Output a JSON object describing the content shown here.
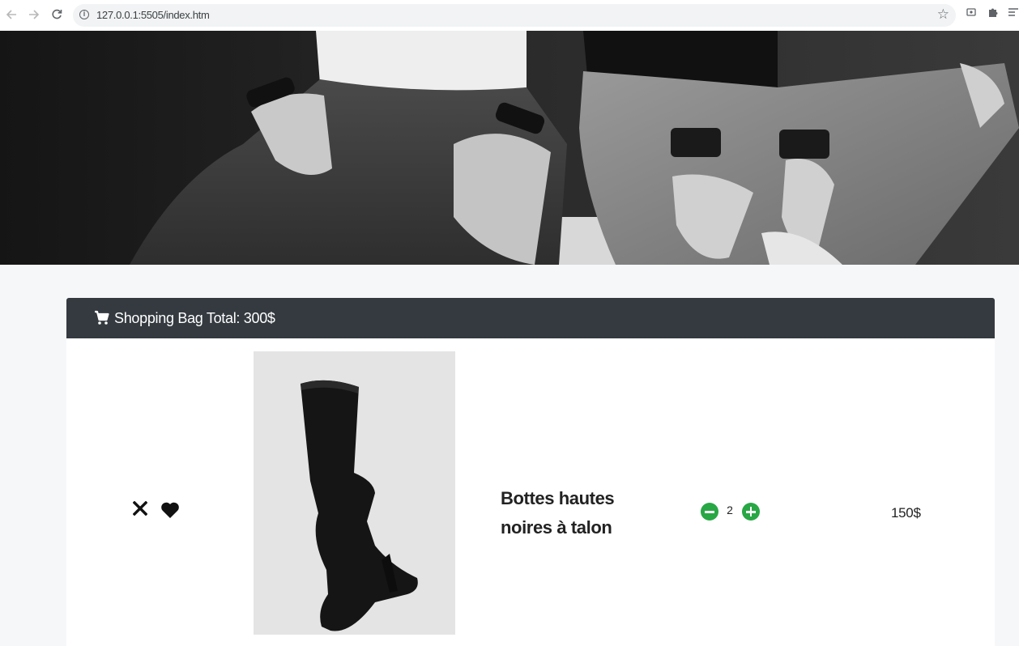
{
  "browser": {
    "back_icon": "arrow-left-icon",
    "forward_icon": "arrow-right-icon",
    "reload_icon": "reload-icon",
    "url": "127.0.0.1:5505/index.htm",
    "bookmark_icon": "star-icon",
    "extension_icons": [
      "media-icon",
      "puzzle-icon",
      "reading-list-icon"
    ]
  },
  "hero": {
    "image": "black-and-white photo of two people sitting in jeans"
  },
  "cart": {
    "header_icon": "shopping-cart-icon",
    "title": "Shopping Bag Total: 300$",
    "items": [
      {
        "remove_icon": "close-icon",
        "favorite_icon": "heart-icon",
        "image": "black thigh-high heeled boot",
        "name_line1": "Bottes hautes",
        "name_line2": "noires à talon",
        "decrease_icon": "minus-circle-icon",
        "quantity": "2",
        "increase_icon": "plus-circle-icon",
        "price": "150$"
      }
    ]
  },
  "colors": {
    "header_bg": "#343a40",
    "qty_button": "#28a745",
    "page_bg": "#f6f7f9"
  }
}
